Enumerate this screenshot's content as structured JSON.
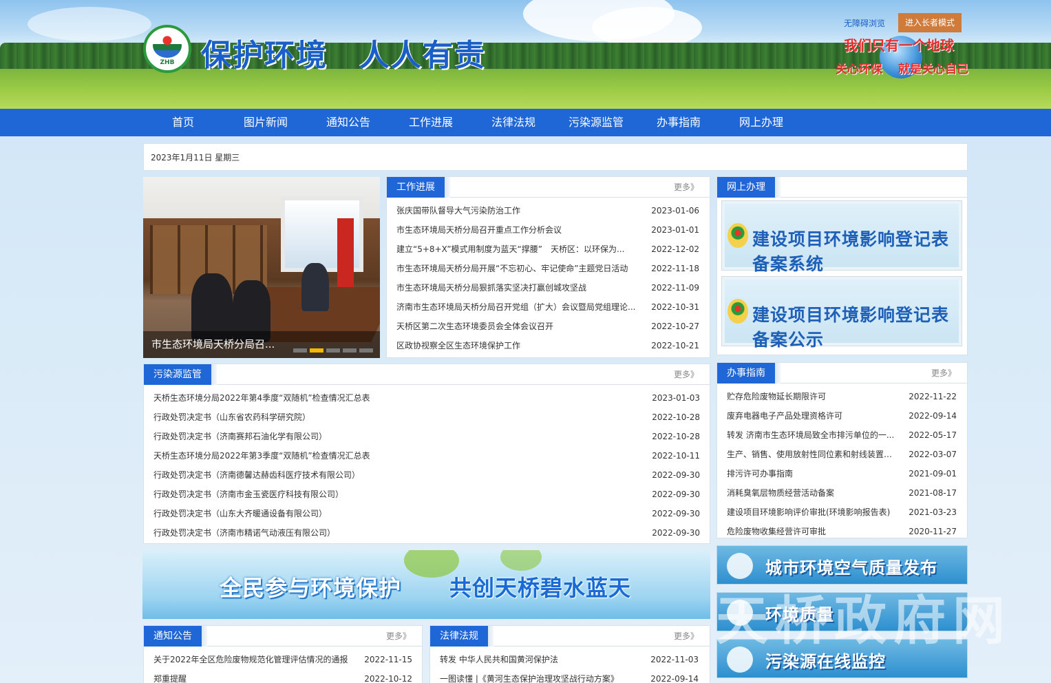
{
  "header": {
    "logo_text": "ZHB",
    "slogan": "保护环境　人人有责",
    "accessibility_link": "无障碍浏览",
    "elder_mode_button": "进入长者模式",
    "earth_slogan_1": "我们只有一个地球",
    "earth_slogan_2a": "关心环保",
    "earth_slogan_2b": "就是关心自己"
  },
  "nav": [
    "首页",
    "图片新闻",
    "通知公告",
    "工作进展",
    "法律法规",
    "污染源监管",
    "办事指南",
    "网上办理"
  ],
  "date_text": "2023年1月11日 星期三",
  "photo_news": {
    "caption": "市生态环境局天桥分局召...",
    "slide_count": 5,
    "active_slide": 2
  },
  "work_progress": {
    "title": "工作进展",
    "more": "更多》",
    "items": [
      {
        "title": "张庆国带队督导大气污染防治工作",
        "date": "2023-01-06"
      },
      {
        "title": "市生态环境局天桥分局召开重点工作分析会议",
        "date": "2023-01-01"
      },
      {
        "title": "建立“5+8+X”模式用制度为蓝天“撑腰”　天桥区：以环保为...",
        "date": "2022-12-02"
      },
      {
        "title": "市生态环境局天桥分局开展“不忘初心、牢记使命”主题党日活动",
        "date": "2022-11-18"
      },
      {
        "title": "市生态环境局天桥分局狠抓落实坚决打赢创城攻坚战",
        "date": "2022-11-09"
      },
      {
        "title": "济南市生态环境局天桥分局召开党组（扩大）会议暨局党组理论...",
        "date": "2022-10-31"
      },
      {
        "title": "天桥区第二次生态环境委员会全体会议召开",
        "date": "2022-10-27"
      },
      {
        "title": "区政协视察全区生态环境保护工作",
        "date": "2022-10-21"
      }
    ]
  },
  "online_service": {
    "title": "网上办理",
    "items": [
      "建设项目环境影响登记表备案系统",
      "建设项目环境影响登记表备案公示"
    ]
  },
  "pollution": {
    "title": "污染源监管",
    "more": "更多》",
    "items": [
      {
        "title": "天桥生态环境分局2022年第4季度“双随机”检查情况汇总表",
        "date": "2023-01-03"
      },
      {
        "title": "行政处罚决定书（山东省农药科学研究院）",
        "date": "2022-10-28"
      },
      {
        "title": "行政处罚决定书（济南赛邦石油化学有限公司）",
        "date": "2022-10-28"
      },
      {
        "title": "天桥生态环境分局2022年第3季度“双随机”检查情况汇总表",
        "date": "2022-10-11"
      },
      {
        "title": "行政处罚决定书（济南德馨达赫齿科医疗技术有限公司）",
        "date": "2022-09-30"
      },
      {
        "title": "行政处罚决定书（济南市金玉瓷医疗科技有限公司）",
        "date": "2022-09-30"
      },
      {
        "title": "行政处罚决定书（山东大齐暖通设备有限公司）",
        "date": "2022-09-30"
      },
      {
        "title": "行政处罚决定书（济南市精诺气动液压有限公司）",
        "date": "2022-09-30"
      }
    ]
  },
  "guide": {
    "title": "办事指南",
    "more": "更多》",
    "items": [
      {
        "title": "贮存危险废物延长期限许可",
        "date": "2022-11-22"
      },
      {
        "title": "废弃电器电子产品处理资格许可",
        "date": "2022-09-14"
      },
      {
        "title": "转发 济南市生态环境局致全市排污单位的一...",
        "date": "2022-05-17"
      },
      {
        "title": "生产、销售、使用放射性同位素和射线装置的...",
        "date": "2022-03-07"
      },
      {
        "title": "排污许可办事指南",
        "date": "2021-09-01"
      },
      {
        "title": "消耗臭氧层物质经营活动备案",
        "date": "2021-08-17"
      },
      {
        "title": "建设项目环境影响评价审批(环境影响报告表)",
        "date": "2021-03-23"
      },
      {
        "title": "危险废物收集经营许可审批",
        "date": "2020-11-27"
      }
    ]
  },
  "banner": {
    "text_1": "全民参与环境保护",
    "text_2": "共创天桥碧水蓝天"
  },
  "quick_links": [
    "城市环境空气质量发布",
    "环境质量",
    "污染源在线监控"
  ],
  "notices": {
    "title": "通知公告",
    "more": "更多》",
    "items": [
      {
        "title": "关于2022年全区危险废物规范化管理评估情况的通报",
        "date": "2022-11-15"
      },
      {
        "title": "郑重提醒",
        "date": "2022-10-12"
      }
    ]
  },
  "laws": {
    "title": "法律法规",
    "more": "更多》",
    "items": [
      {
        "title": "转发 中华人民共和国黄河保护法",
        "date": "2022-11-03"
      },
      {
        "title": "一图读懂 |《黄河生态保护治理攻坚战行动方案》",
        "date": "2022-09-14"
      }
    ]
  },
  "watermark": "天桥政府网",
  "colors": {
    "nav_blue": "#1f66d6",
    "elder_button": "#d07b3a",
    "slogan_red": "#e62c2c"
  }
}
